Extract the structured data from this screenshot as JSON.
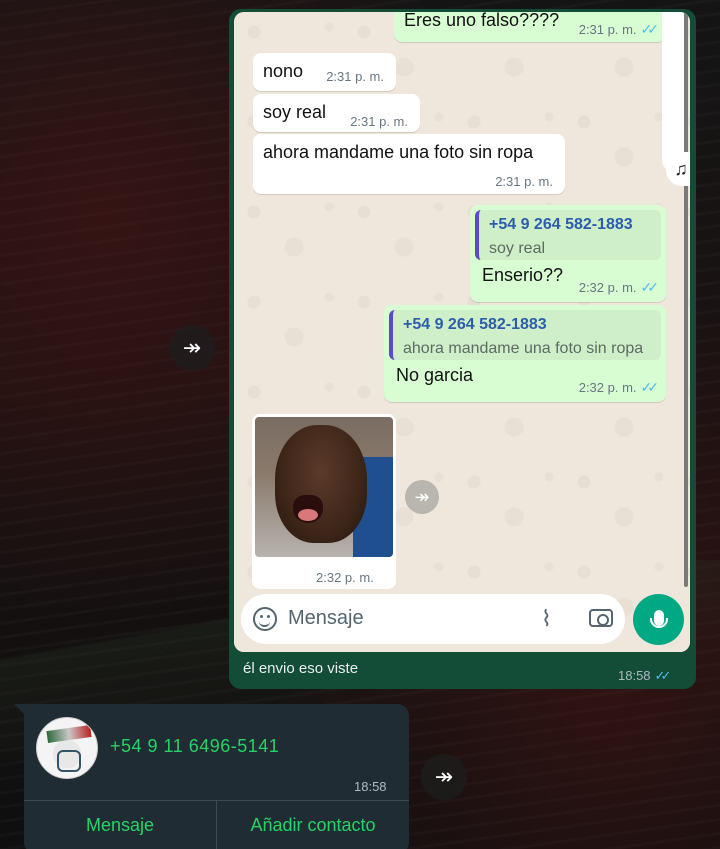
{
  "chat_screenshot": {
    "messages": [
      {
        "id": "m0",
        "dir": "out",
        "text": "Eres uno falso????",
        "time": "2:31 p. m.",
        "ticks": "✓✓"
      },
      {
        "id": "m1",
        "dir": "in",
        "text": "nono",
        "time": "2:31 p. m."
      },
      {
        "id": "m2",
        "dir": "in",
        "text": "soy real",
        "time": "2:31 p. m."
      },
      {
        "id": "m3",
        "dir": "in",
        "text": "ahora mandame una foto sin ropa",
        "time": "2:31 p. m."
      },
      {
        "id": "m4",
        "dir": "out",
        "quote_name": "+54 9 264 582-1883",
        "quote_text": "soy real",
        "text": "Enserio??",
        "time": "2:32 p. m.",
        "ticks": "✓✓"
      },
      {
        "id": "m5",
        "dir": "out",
        "quote_name": "+54 9 264 582-1883",
        "quote_text": "ahora mandame una foto sin ropa",
        "text": "No garcia",
        "time": "2:32 p. m.",
        "ticks": "✓✓"
      },
      {
        "id": "m6",
        "dir": "in",
        "type": "photo",
        "time": "2:32 p. m."
      }
    ],
    "composer": {
      "placeholder": "Mensaje"
    },
    "icons": {
      "music": "music-note-icon",
      "forward": "forward-icon",
      "emoji": "emoji-icon",
      "attach": "paperclip-icon",
      "camera": "camera-icon",
      "mic": "microphone-icon"
    },
    "glyphs": {
      "music": "♫",
      "forward": "↠",
      "clip": "⌇"
    }
  },
  "outer_message": {
    "caption": "él envio eso viste",
    "time": "18:58",
    "ticks": "✓✓"
  },
  "contact_card": {
    "number": "+54 9 11 6496-5141",
    "time": "18:58",
    "actions": [
      "Mensaje",
      "Añadir contacto"
    ]
  },
  "colors": {
    "accent_green": "#25d366",
    "mic_green": "#00a884",
    "outgoing_bubble": "#d9fdd3",
    "dark_sent_bubble": "#134d37",
    "read_tick": "#53bdeb",
    "quote_bar": "#5e49c9"
  }
}
